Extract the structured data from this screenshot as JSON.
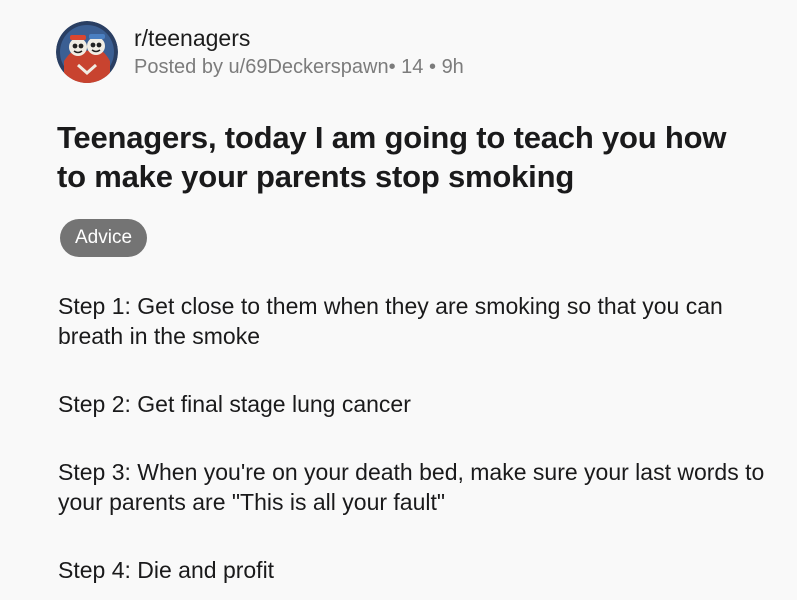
{
  "post": {
    "subreddit": "r/teenagers",
    "posted_by_prefix": "Posted by ",
    "username": "u/69Deckerspawn",
    "user_flair": "• 14",
    "separator": "•",
    "age": "9h",
    "avatar_icon": "subreddit-avatar-icon",
    "title": "Teenagers, today I am going to teach you how to make your parents stop smoking",
    "flair": "Advice",
    "steps": [
      "Step 1: Get close to them when they are smoking so that you can breath in the smoke",
      "Step 2: Get final stage lung cancer",
      "Step 3: When you're on your death bed, make sure your last words to your parents are \"This is all your fault\"",
      "Step 4: Die and profit"
    ]
  },
  "colors": {
    "background": "#f9f9f9",
    "text": "#1a1a1b",
    "meta": "#7c7c7c",
    "flair_bg": "#747474"
  }
}
